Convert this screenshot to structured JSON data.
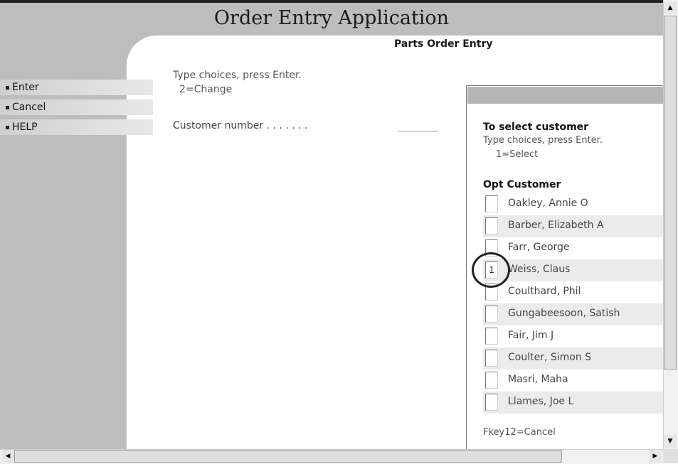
{
  "app": {
    "title": "Order Entry Application"
  },
  "screen": {
    "title": "Parts Order Entry",
    "instruction": "Type choices, press Enter.",
    "option_hint": "2=Change",
    "customer_label": "Customer number . . . . . . .",
    "customer_value": ""
  },
  "fkeys": [
    {
      "label": "Enter"
    },
    {
      "label": "Cancel"
    },
    {
      "label": "HELP"
    }
  ],
  "popup": {
    "title": "To select customer",
    "instruction": "Type choices, press Enter.",
    "option_hint": "1=Select",
    "header": "Opt Customer",
    "customers": [
      {
        "opt": "",
        "name": "Oakley, Annie O"
      },
      {
        "opt": "",
        "name": "Barber, Elizabeth A"
      },
      {
        "opt": "",
        "name": "Farr, George"
      },
      {
        "opt": "1",
        "name": "Weiss, Claus"
      },
      {
        "opt": "",
        "name": "Coulthard, Phil"
      },
      {
        "opt": "",
        "name": "Gungabeesoon, Satish"
      },
      {
        "opt": "",
        "name": "Fair, Jim J"
      },
      {
        "opt": "",
        "name": "Coulter, Simon S"
      },
      {
        "opt": "",
        "name": "Masri, Maha"
      },
      {
        "opt": "",
        "name": "Llames, Joe L"
      }
    ],
    "fkey_hint": "Fkey12=Cancel"
  },
  "icons": {
    "scroll_up": "triangle-up",
    "scroll_down": "triangle-down",
    "scroll_left": "triangle-left",
    "scroll_right": "triangle-right"
  }
}
